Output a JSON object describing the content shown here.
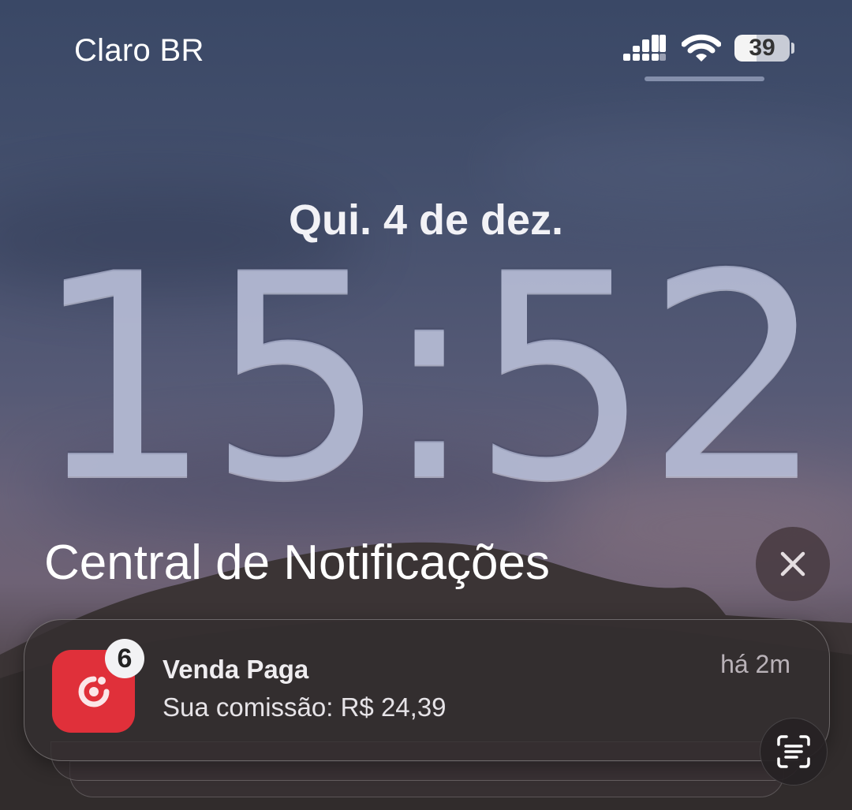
{
  "status_bar": {
    "carrier": "Claro BR",
    "battery_level": "39",
    "icons": [
      "signal-icon",
      "wifi-icon",
      "battery-icon"
    ]
  },
  "lock_screen": {
    "date": "Qui. 4 de dez.",
    "time": "15:52"
  },
  "notification_center": {
    "title": "Central de Notificações",
    "close_icon": "close-icon"
  },
  "notification": {
    "badge_count": "6",
    "title": "Venda Paga",
    "body": "Sua comissão: R$ 24,39",
    "time": "há 2m",
    "app_icon_color": "#e0303a",
    "action_icon": "live-text-scan-icon"
  }
}
